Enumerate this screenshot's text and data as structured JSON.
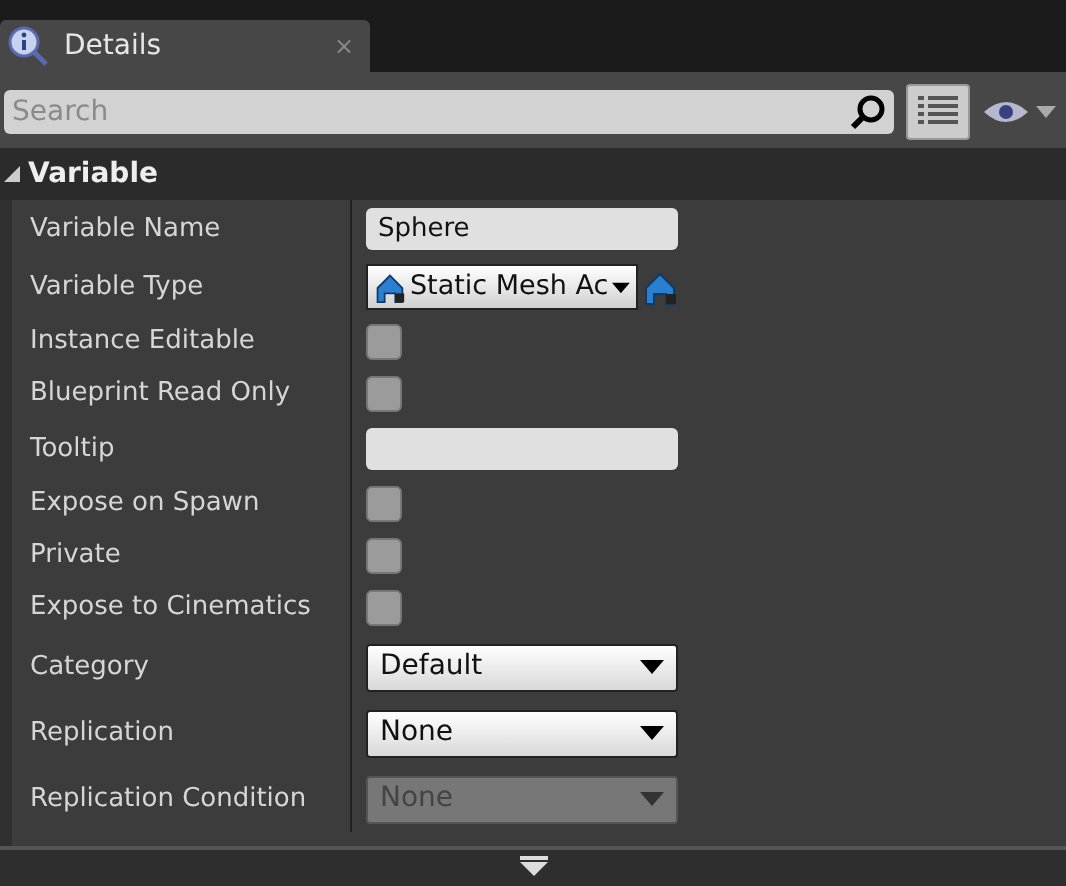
{
  "tab": {
    "title": "Details",
    "close": "×"
  },
  "search": {
    "placeholder": "Search"
  },
  "section": {
    "title": "Variable",
    "expanded": true
  },
  "rows": [
    {
      "label": "Variable Name",
      "kind": "text",
      "value": "Sphere"
    },
    {
      "label": "Variable Type",
      "kind": "type",
      "value": "Static Mesh Ac"
    },
    {
      "label": "Instance Editable",
      "kind": "checkbox",
      "checked": false
    },
    {
      "label": "Blueprint Read Only",
      "kind": "checkbox",
      "checked": false
    },
    {
      "label": "Tooltip",
      "kind": "text",
      "value": ""
    },
    {
      "label": "Expose on Spawn",
      "kind": "checkbox",
      "checked": false
    },
    {
      "label": "Private",
      "kind": "checkbox",
      "checked": false
    },
    {
      "label": "Expose to Cinematics",
      "kind": "checkbox",
      "checked": false
    },
    {
      "label": "Category",
      "kind": "combo",
      "value": "Default",
      "disabled": false
    },
    {
      "label": "Replication",
      "kind": "combo",
      "value": "None",
      "disabled": false
    },
    {
      "label": "Replication Condition",
      "kind": "combo",
      "value": "None",
      "disabled": true
    }
  ]
}
